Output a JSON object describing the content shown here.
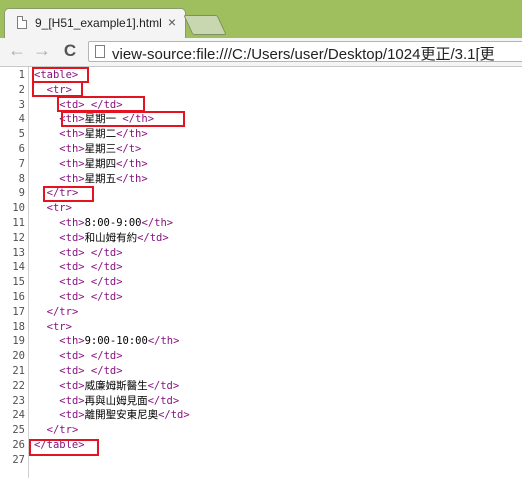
{
  "tab": {
    "title": "9_[H51_example1].html",
    "close_glyph": "×"
  },
  "toolbar": {
    "back_glyph": "←",
    "forward_glyph": "→",
    "reload_glyph": "C",
    "url": "view-source:file:///C:/Users/user/Desktop/1024更正/3.1[更"
  },
  "colors": {
    "tag": "#881280",
    "text": "#000000",
    "highlight": "#e3141f",
    "tab_strip": "#9fbe5d"
  },
  "source_lines": [
    {
      "n": "1",
      "indent": "",
      "parts": [
        [
          "tag",
          "<table>"
        ]
      ]
    },
    {
      "n": "2",
      "indent": "  ",
      "parts": [
        [
          "tag",
          "<tr>"
        ]
      ]
    },
    {
      "n": "3",
      "indent": "    ",
      "parts": [
        [
          "tag",
          "<td>"
        ],
        [
          "txt",
          " "
        ],
        [
          "tag",
          "</td>"
        ]
      ]
    },
    {
      "n": "4",
      "indent": "    ",
      "parts": [
        [
          "tag",
          "<th>"
        ],
        [
          "txt",
          "星期一 "
        ],
        [
          "tag",
          "</th>"
        ]
      ]
    },
    {
      "n": "5",
      "indent": "    ",
      "parts": [
        [
          "tag",
          "<th>"
        ],
        [
          "txt",
          "星期二"
        ],
        [
          "tag",
          "</th>"
        ]
      ]
    },
    {
      "n": "6",
      "indent": "    ",
      "parts": [
        [
          "tag",
          "<th>"
        ],
        [
          "txt",
          "星期三"
        ],
        [
          "tag",
          "</t>"
        ]
      ]
    },
    {
      "n": "7",
      "indent": "    ",
      "parts": [
        [
          "tag",
          "<th>"
        ],
        [
          "txt",
          "星期四"
        ],
        [
          "tag",
          "</th>"
        ]
      ]
    },
    {
      "n": "8",
      "indent": "    ",
      "parts": [
        [
          "tag",
          "<th>"
        ],
        [
          "txt",
          "星期五"
        ],
        [
          "tag",
          "</th>"
        ]
      ]
    },
    {
      "n": "9",
      "indent": "  ",
      "parts": [
        [
          "tag",
          "</tr>"
        ]
      ]
    },
    {
      "n": "10",
      "indent": "  ",
      "parts": [
        [
          "tag",
          "<tr>"
        ]
      ]
    },
    {
      "n": "11",
      "indent": "    ",
      "parts": [
        [
          "tag",
          "<th>"
        ],
        [
          "txt",
          "8:00-9:00"
        ],
        [
          "tag",
          "</th>"
        ]
      ]
    },
    {
      "n": "12",
      "indent": "    ",
      "parts": [
        [
          "tag",
          "<td>"
        ],
        [
          "txt",
          "和山姆有約"
        ],
        [
          "tag",
          "</td>"
        ]
      ]
    },
    {
      "n": "13",
      "indent": "    ",
      "parts": [
        [
          "tag",
          "<td>"
        ],
        [
          "txt",
          " "
        ],
        [
          "tag",
          "</td>"
        ]
      ]
    },
    {
      "n": "14",
      "indent": "    ",
      "parts": [
        [
          "tag",
          "<td>"
        ],
        [
          "txt",
          " "
        ],
        [
          "tag",
          "</td>"
        ]
      ]
    },
    {
      "n": "15",
      "indent": "    ",
      "parts": [
        [
          "tag",
          "<td>"
        ],
        [
          "txt",
          " "
        ],
        [
          "tag",
          "</td>"
        ]
      ]
    },
    {
      "n": "16",
      "indent": "    ",
      "parts": [
        [
          "tag",
          "<td>"
        ],
        [
          "txt",
          " "
        ],
        [
          "tag",
          "</td>"
        ]
      ]
    },
    {
      "n": "17",
      "indent": "  ",
      "parts": [
        [
          "tag",
          "</tr>"
        ]
      ]
    },
    {
      "n": "18",
      "indent": "  ",
      "parts": [
        [
          "tag",
          "<tr>"
        ]
      ]
    },
    {
      "n": "19",
      "indent": "    ",
      "parts": [
        [
          "tag",
          "<th>"
        ],
        [
          "txt",
          "9:00-10:00"
        ],
        [
          "tag",
          "</th>"
        ]
      ]
    },
    {
      "n": "20",
      "indent": "    ",
      "parts": [
        [
          "tag",
          "<td>"
        ],
        [
          "txt",
          " "
        ],
        [
          "tag",
          "</td>"
        ]
      ]
    },
    {
      "n": "21",
      "indent": "    ",
      "parts": [
        [
          "tag",
          "<td>"
        ],
        [
          "txt",
          " "
        ],
        [
          "tag",
          "</td>"
        ]
      ]
    },
    {
      "n": "22",
      "indent": "    ",
      "parts": [
        [
          "tag",
          "<td>"
        ],
        [
          "txt",
          "威廉姆斯醫生"
        ],
        [
          "tag",
          "</td>"
        ]
      ]
    },
    {
      "n": "23",
      "indent": "    ",
      "parts": [
        [
          "tag",
          "<td>"
        ],
        [
          "txt",
          "再與山姆見面"
        ],
        [
          "tag",
          "</td>"
        ]
      ]
    },
    {
      "n": "24",
      "indent": "    ",
      "parts": [
        [
          "tag",
          "<td>"
        ],
        [
          "txt",
          "離開聖安東尼奧"
        ],
        [
          "tag",
          "</td>"
        ]
      ]
    },
    {
      "n": "25",
      "indent": "  ",
      "parts": [
        [
          "tag",
          "</tr>"
        ]
      ]
    },
    {
      "n": "26",
      "indent": "",
      "parts": [
        [
          "tag",
          "</table>"
        ]
      ]
    },
    {
      "n": "27",
      "indent": "",
      "parts": []
    }
  ]
}
